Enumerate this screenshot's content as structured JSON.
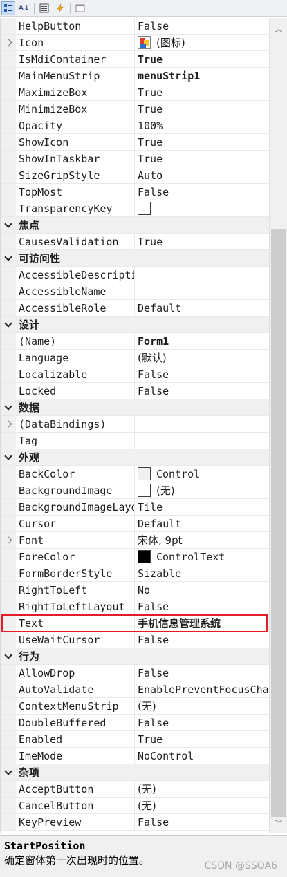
{
  "toolbar": {
    "buttons": [
      "categorized-icon",
      "alphabetical-icon",
      "properties-icon",
      "events-icon",
      "property-pages-icon"
    ],
    "alpha_label": "A↓"
  },
  "rows": [
    {
      "kind": "prop",
      "name": "HelpButton",
      "value": "False"
    },
    {
      "kind": "prop",
      "name": "Icon",
      "value": "(图标)",
      "expand": true,
      "icon": "image"
    },
    {
      "kind": "prop",
      "name": "IsMdiContainer",
      "value": "True",
      "bold": true
    },
    {
      "kind": "prop",
      "name": "MainMenuStrip",
      "value": "menuStrip1",
      "bold": true
    },
    {
      "kind": "prop",
      "name": "MaximizeBox",
      "value": "True"
    },
    {
      "kind": "prop",
      "name": "MinimizeBox",
      "value": "True"
    },
    {
      "kind": "prop",
      "name": "Opacity",
      "value": "100%"
    },
    {
      "kind": "prop",
      "name": "ShowIcon",
      "value": "True"
    },
    {
      "kind": "prop",
      "name": "ShowInTaskbar",
      "value": "True"
    },
    {
      "kind": "prop",
      "name": "SizeGripStyle",
      "value": "Auto"
    },
    {
      "kind": "prop",
      "name": "TopMost",
      "value": "False"
    },
    {
      "kind": "prop",
      "name": "TransparencyKey",
      "value": "",
      "swatch": "#ffffff"
    },
    {
      "kind": "cat",
      "name": "焦点"
    },
    {
      "kind": "prop",
      "name": "CausesValidation",
      "value": "True"
    },
    {
      "kind": "cat",
      "name": "可访问性"
    },
    {
      "kind": "prop",
      "name": "AccessibleDescripti",
      "value": ""
    },
    {
      "kind": "prop",
      "name": "AccessibleName",
      "value": ""
    },
    {
      "kind": "prop",
      "name": "AccessibleRole",
      "value": "Default"
    },
    {
      "kind": "cat",
      "name": "设计"
    },
    {
      "kind": "prop",
      "name": "(Name)",
      "value": "Form1",
      "bold": true
    },
    {
      "kind": "prop",
      "name": "Language",
      "value": "(默认)"
    },
    {
      "kind": "prop",
      "name": "Localizable",
      "value": "False"
    },
    {
      "kind": "prop",
      "name": "Locked",
      "value": "False"
    },
    {
      "kind": "cat",
      "name": "数据"
    },
    {
      "kind": "prop",
      "name": "(DataBindings)",
      "value": "",
      "expand": true
    },
    {
      "kind": "prop",
      "name": "Tag",
      "value": ""
    },
    {
      "kind": "cat",
      "name": "外观"
    },
    {
      "kind": "prop",
      "name": "BackColor",
      "value": "Control",
      "swatch": "#f0f0f0"
    },
    {
      "kind": "prop",
      "name": "BackgroundImage",
      "value": "(无)",
      "swatch": "#ffffff"
    },
    {
      "kind": "prop",
      "name": "BackgroundImageLayo",
      "value": "Tile"
    },
    {
      "kind": "prop",
      "name": "Cursor",
      "value": "Default"
    },
    {
      "kind": "prop",
      "name": "Font",
      "value": "宋体, 9pt",
      "expand": true
    },
    {
      "kind": "prop",
      "name": "ForeColor",
      "value": "ControlText",
      "swatch": "#000000"
    },
    {
      "kind": "prop",
      "name": "FormBorderStyle",
      "value": "Sizable"
    },
    {
      "kind": "prop",
      "name": "RightToLeft",
      "value": "No"
    },
    {
      "kind": "prop",
      "name": "RightToLeftLayout",
      "value": "False"
    },
    {
      "kind": "prop",
      "name": "Text",
      "value": "手机信息管理系统",
      "bold": true,
      "selected": true
    },
    {
      "kind": "prop",
      "name": "UseWaitCursor",
      "value": "False"
    },
    {
      "kind": "cat",
      "name": "行为"
    },
    {
      "kind": "prop",
      "name": "AllowDrop",
      "value": "False"
    },
    {
      "kind": "prop",
      "name": "AutoValidate",
      "value": "EnablePreventFocusCha"
    },
    {
      "kind": "prop",
      "name": "ContextMenuStrip",
      "value": "(无)"
    },
    {
      "kind": "prop",
      "name": "DoubleBuffered",
      "value": "False"
    },
    {
      "kind": "prop",
      "name": "Enabled",
      "value": "True"
    },
    {
      "kind": "prop",
      "name": "ImeMode",
      "value": "NoControl"
    },
    {
      "kind": "cat",
      "name": "杂项"
    },
    {
      "kind": "prop",
      "name": "AcceptButton",
      "value": "(无)"
    },
    {
      "kind": "prop",
      "name": "CancelButton",
      "value": "(无)"
    },
    {
      "kind": "prop",
      "name": "KeyPreview",
      "value": "False"
    }
  ],
  "description": {
    "title": "StartPosition",
    "text": "确定窗体第一次出现时的位置。"
  },
  "watermark": "CSDN @SSOA6",
  "colors": {
    "selection_border": "#e11d2a",
    "category_bg": "#f0f0f0",
    "scroll_thumb": "#cdcdcd"
  }
}
